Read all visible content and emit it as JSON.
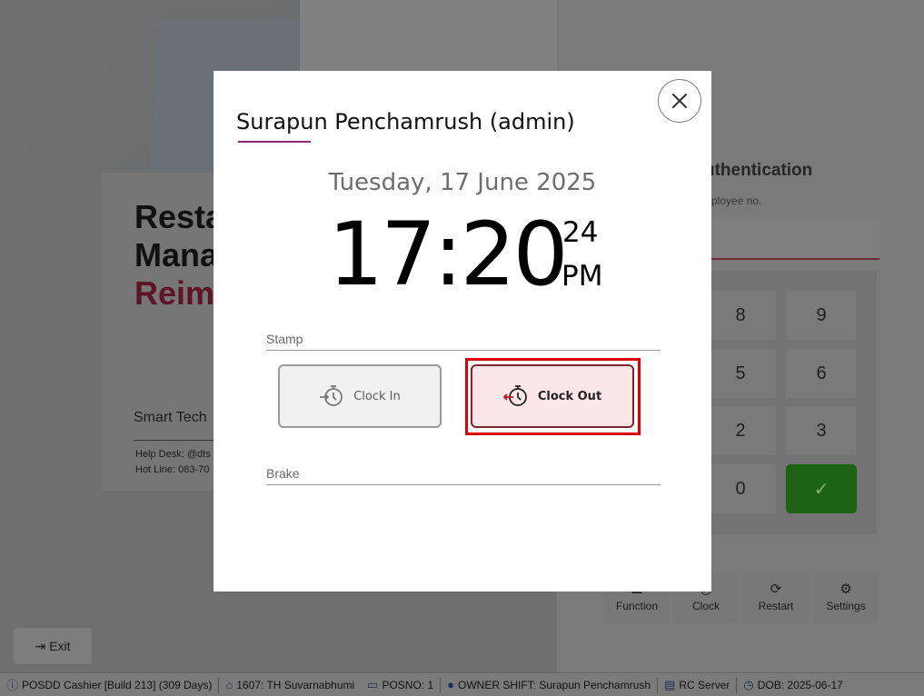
{
  "background": {
    "brand": {
      "line1": "Resta",
      "line2": "Mana",
      "line3": "Reim",
      "company": "Smart Tech",
      "help_desk": "Help Desk: @dts",
      "hot_line": "Hot Line: 083-70"
    },
    "auth": {
      "title": "uthentication",
      "subtitle": "ployee no."
    },
    "keypad": {
      "keys": [
        "8",
        "9",
        "5",
        "6",
        "2",
        "3",
        "0"
      ]
    },
    "toolbar": [
      {
        "label": "Function",
        "icon": "function-icon"
      },
      {
        "label": "Clock",
        "icon": "clock-icon"
      },
      {
        "label": "Restart",
        "icon": "restart-icon"
      },
      {
        "label": "Settings",
        "icon": "gear-icon"
      }
    ],
    "exit_label": "Exit"
  },
  "statusbar": {
    "app": "POSDD Cashier [Build 213] (309 Days)",
    "branch": "1607: TH Suvarnabhumi",
    "posno": "POSNO: 1",
    "shift": "OWNER SHIFT: Surapun Penchamrush",
    "server": "RC Server",
    "dob": "DOB: 2025-06-17"
  },
  "modal": {
    "employee_name": "Surapun Penchamrush (admin)",
    "date": "Tuesday, 17 June 2025",
    "time_hm": "17:20",
    "time_sec": "24",
    "time_ampm": "PM",
    "stamp_label": "Stamp",
    "clock_in_label": "Clock In",
    "clock_out_label": "Clock Out",
    "brake_label": "Brake",
    "accent_color": "#e00000"
  }
}
